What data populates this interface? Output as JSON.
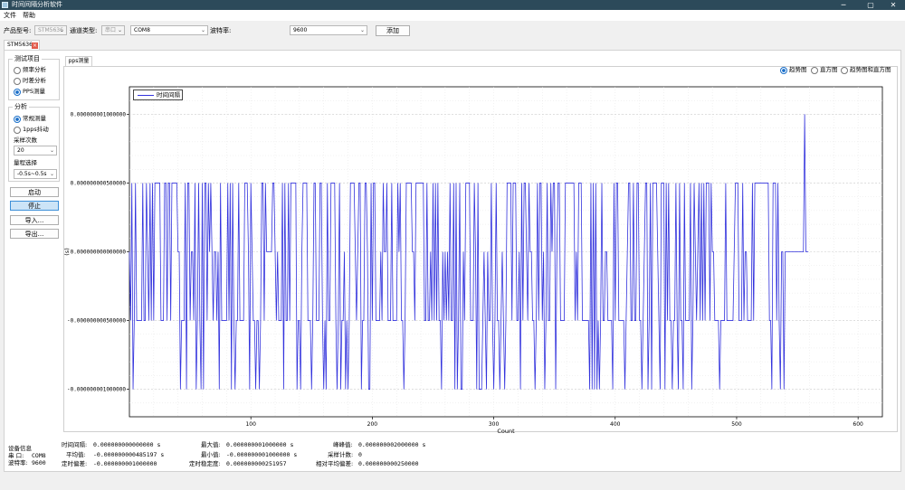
{
  "window": {
    "title": "时间间隔分析软件"
  },
  "menu": [
    "文件",
    "帮助"
  ],
  "toolbar": {
    "product_label": "产品型号:",
    "product_value": "STM5636",
    "channel_label": "通道类型:",
    "channel_value": "串口",
    "port_value": "COM8",
    "baud_label": "波特率:",
    "baud_value": "9600",
    "add_label": "添加"
  },
  "doc_tab": "STM5636",
  "test_group": {
    "title": "测试项目",
    "options": [
      "频率分析",
      "时差分析",
      "PPS测量"
    ],
    "selected": "PPS测量"
  },
  "analysis_group": {
    "title": "分析",
    "options": [
      "常规测量",
      "1pps抖动"
    ],
    "selected": "常规测量"
  },
  "sample_count": {
    "label": "采样次数",
    "value": "20"
  },
  "range_select": {
    "label": "量程选择",
    "value": "-0.5s~0.5s"
  },
  "buttons": {
    "start": "启动",
    "stop": "停止",
    "import": "导入...",
    "export": "导出..."
  },
  "inner_tab": "pps测量",
  "view_options": {
    "options": [
      "趋势图",
      "直方图",
      "趋势图和直方图"
    ],
    "selected": "趋势图"
  },
  "chart_data": {
    "type": "line",
    "xlabel": "Count",
    "ylabel": "(s)",
    "xlim": [
      0,
      620
    ],
    "ylim": [
      -1.2e-09,
      1.2e-09
    ],
    "x_ticks": [
      100,
      200,
      300,
      400,
      500,
      600
    ],
    "y_ticks": [
      {
        "value": 1e-09,
        "label": "0.000000001000000"
      },
      {
        "value": 5e-10,
        "label": "0.000000000500000"
      },
      {
        "value": 0,
        "label": "0.000000000000000"
      },
      {
        "value": -5e-10,
        "label": "-0.000000000500000"
      },
      {
        "value": -1e-09,
        "label": "-0.000000001000000"
      }
    ],
    "series": [
      {
        "name": "时间间隔",
        "color": "#3333dd",
        "levels": [
          -1e-09,
          -5e-10,
          0,
          5e-10,
          1e-09
        ],
        "codes": "21301311111311321313133333111331331333332201113033122130131030331323212212031111131303101131111333203211011013313222223321211130311313333301102333311101331113310103113333101301120101333321233011332003133111121322311131111323110133333221333333311311213131311021212131130301300213333111320300012102113101311012101333313331120313321322110131331201311323302331111333333331213331111110303030101311221111031331111101233113113311012330130333321033303131101131031103111130132123131313331322111101111311111123331113122111131333333333333110333131022022222222222222224222"
      }
    ]
  },
  "device_info": {
    "title": "设备信息",
    "port_label": "串 口:",
    "port_value": "COM8",
    "baud_label": "波特率:",
    "baud_value": "9600"
  },
  "stats": {
    "interval_label": "时间间隔:",
    "interval_value": "0.000000000000000  s",
    "avg_label": "平均值:",
    "avg_value": "-0.000000000485197  s",
    "accuracy_label": "定时偏差:",
    "accuracy_value": "-0.000000001000000",
    "max_label": "最大值:",
    "max_value": "0.000000001000000  s",
    "min_label": "最小值:",
    "min_value": "-0.000000001000000  s",
    "stability_label": "定时稳定度:",
    "stability_value": "0.000000000251957",
    "pp_label": "峰峰值:",
    "pp_value": "0.000000002000000  s",
    "count_label": "采样计数:",
    "count_value": "0",
    "relavg_label": "相对平均偏差:",
    "relavg_value": "0.000000000250000"
  }
}
